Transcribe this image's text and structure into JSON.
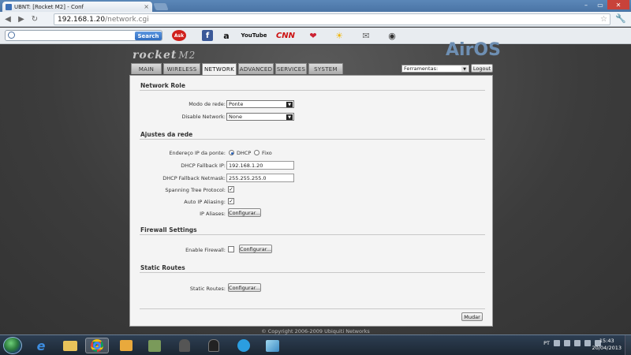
{
  "browser": {
    "tab_title": "UBNT: [Rocket M2] - Conf",
    "tab_close": "×",
    "url_host": "192.168.1.20",
    "url_path": "/network.cgi",
    "search_button": "Search",
    "toolbar_icons": [
      "ask-icon",
      "facebook-icon",
      "amazon-icon",
      "youtube-icon",
      "cnn-icon",
      "pin-icon",
      "weather-icon",
      "mail-icon",
      "radio-icon"
    ],
    "youtube_label": "YouTube",
    "cnn_label": "CNN",
    "amazon_label": "a",
    "facebook_label": "f",
    "ask_label": "Ask"
  },
  "header": {
    "product_logo": "rocket",
    "product_model": "M2",
    "brand_logo": "AirOS"
  },
  "nav": {
    "tabs": [
      {
        "label": "MAIN",
        "active": false
      },
      {
        "label": "WIRELESS",
        "active": false
      },
      {
        "label": "NETWORK",
        "active": true
      },
      {
        "label": "ADVANCED",
        "active": false
      },
      {
        "label": "SERVICES",
        "active": false
      },
      {
        "label": "SYSTEM",
        "active": false
      }
    ],
    "tools_select": "Ferramentas:",
    "logout": "Logout"
  },
  "network_role": {
    "title": "Network Role",
    "mode_label": "Modo de rede:",
    "mode_value": "Ponte",
    "disable_label": "Disable Network:",
    "disable_value": "None"
  },
  "network_settings": {
    "title": "Ajustes da rede",
    "bridge_ip_label": "Endereço IP da ponte:",
    "opt_dhcp": "DHCP",
    "opt_fixed": "Fixo",
    "fallback_ip_label": "DHCP Fallback IP:",
    "fallback_ip_value": "192.168.1.20",
    "fallback_mask_label": "DHCP Fallback Netmask:",
    "fallback_mask_value": "255.255.255.0",
    "stp_label": "Spanning Tree Protocol:",
    "aliasing_label": "Auto IP Aliasing:",
    "aliases_label": "IP Aliases:",
    "aliases_button": "Configurar..."
  },
  "firewall": {
    "title": "Firewall Settings",
    "enable_label": "Enable Firewall:",
    "config_button": "Configurar..."
  },
  "routes": {
    "title": "Static Routes",
    "label": "Static Routes:",
    "config_button": "Configurar..."
  },
  "footer": {
    "apply_button": "Mudar",
    "copyright": "© Copyright 2006-2009 Ubiquiti Networks"
  },
  "taskbar": {
    "lang": "PT",
    "time": "15:43",
    "date": "20/04/2013"
  },
  "colors": {
    "tabbar": "#4a74a5",
    "panel": "#f4f4f4",
    "airos": "#6e8fb3",
    "taskbar": "#1c2733"
  }
}
